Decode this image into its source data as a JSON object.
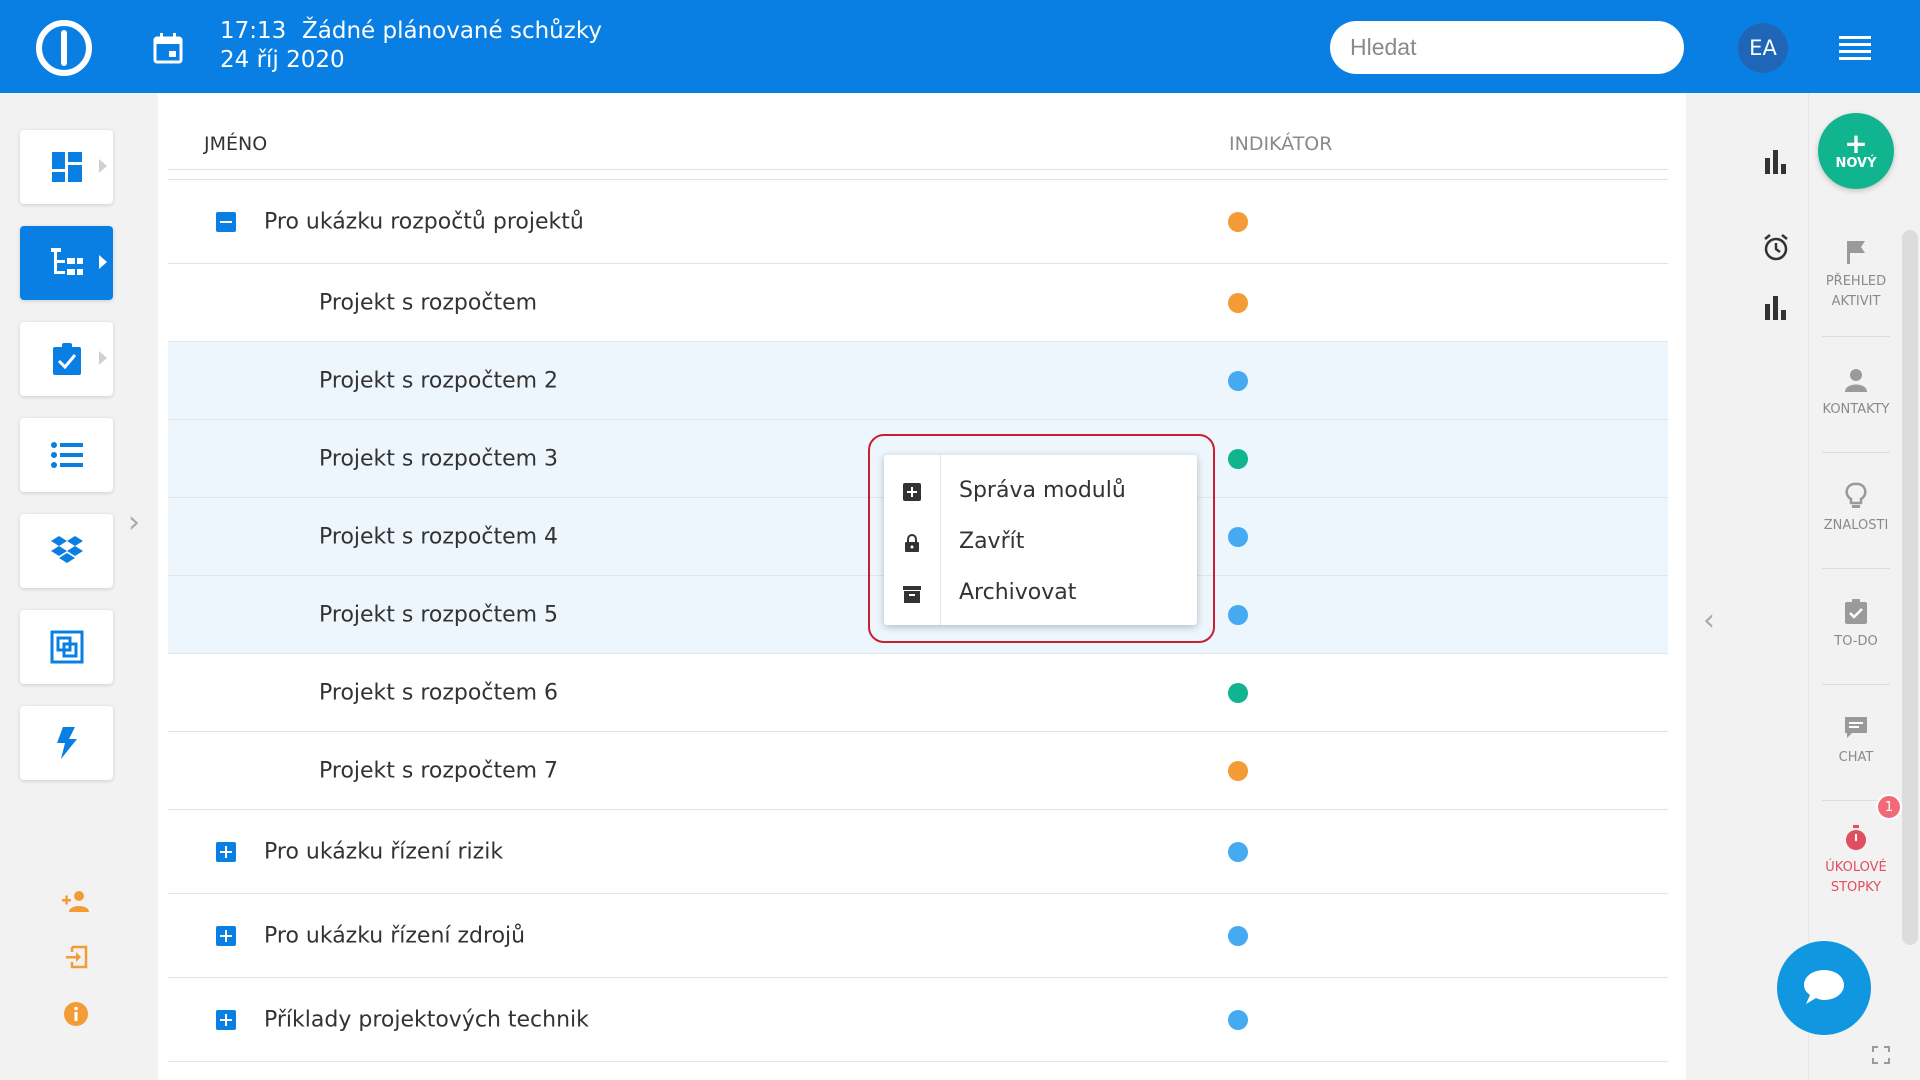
{
  "header": {
    "time": "17:13",
    "meeting": "Žádné plánované schůzky",
    "date": "24 říj 2020",
    "search_placeholder": "Hledat",
    "avatar": "EA",
    "logo_icon": "power-logo-icon",
    "calendar_icon": "calendar-icon",
    "menu_icon": "hamburger-icon"
  },
  "left_nav": {
    "items": [
      {
        "icon": "dashboard-icon",
        "active": false,
        "has_arrow": true
      },
      {
        "icon": "project-tree-icon",
        "active": true,
        "has_arrow": true
      },
      {
        "icon": "clipboard-check-icon",
        "active": false,
        "has_arrow": true
      },
      {
        "icon": "list-icon",
        "active": false,
        "has_arrow": false
      },
      {
        "icon": "dropbox-icon",
        "active": false,
        "has_arrow": false
      },
      {
        "icon": "resource-icon",
        "active": false,
        "has_arrow": false
      },
      {
        "icon": "lightning-icon",
        "active": false,
        "has_arrow": false
      }
    ],
    "bottom_icons": [
      "add-user-icon",
      "sign-in-icon",
      "info-icon"
    ],
    "accent": "#0a7fe3",
    "orange": "#f39c35"
  },
  "table": {
    "col_name": "JMÉNO",
    "col_indicator": "INDIKÁTOR",
    "rows": [
      {
        "label": "Pro ukázku rozpočtů projektů",
        "level": 0,
        "toggle": "minus",
        "indicator": "#f39c35",
        "selected": false
      },
      {
        "label": "Projekt s rozpočtem",
        "level": 1,
        "toggle": "",
        "indicator": "#f39c35",
        "selected": false
      },
      {
        "label": "Projekt s rozpočtem 2",
        "level": 1,
        "toggle": "",
        "indicator": "#45aaf2",
        "selected": true
      },
      {
        "label": "Projekt s rozpočtem 3",
        "level": 1,
        "toggle": "",
        "indicator": "#10b58f",
        "selected": true
      },
      {
        "label": "Projekt s rozpočtem 4",
        "level": 1,
        "toggle": "",
        "indicator": "#45aaf2",
        "selected": true
      },
      {
        "label": "Projekt s rozpočtem 5",
        "level": 1,
        "toggle": "",
        "indicator": "#45aaf2",
        "selected": true
      },
      {
        "label": "Projekt s rozpočtem 6",
        "level": 1,
        "toggle": "",
        "indicator": "#10b58f",
        "selected": false
      },
      {
        "label": "Projekt s rozpočtem 7",
        "level": 1,
        "toggle": "",
        "indicator": "#f39c35",
        "selected": false
      },
      {
        "label": "Pro ukázku řízení rizik",
        "level": 0,
        "toggle": "plus",
        "indicator": "#45aaf2",
        "selected": false
      },
      {
        "label": "Pro ukázku řízení zdrojů",
        "level": 0,
        "toggle": "plus",
        "indicator": "#45aaf2",
        "selected": false
      },
      {
        "label": "Příklady projektových technik",
        "level": 0,
        "toggle": "plus",
        "indicator": "#45aaf2",
        "selected": false
      }
    ]
  },
  "context_menu": {
    "items": [
      {
        "label": "Správa modulů",
        "icon": "plus-square-icon"
      },
      {
        "label": "Zavřít",
        "icon": "lock-icon"
      },
      {
        "label": "Archivovat",
        "icon": "archive-icon"
      }
    ],
    "highlight_color": "#c9202f"
  },
  "right_sidebar": {
    "new_button": "NOVÝ",
    "items": [
      {
        "label_lines": [
          "PŘEHLED",
          "AKTIVIT"
        ],
        "icon": "flag-icon"
      },
      {
        "label_lines": [
          "KONTAKTY"
        ],
        "icon": "person-icon"
      },
      {
        "label_lines": [
          "ZNALOSTI"
        ],
        "icon": "lightbulb-icon"
      },
      {
        "label_lines": [
          "TO-DO"
        ],
        "icon": "todo-icon"
      },
      {
        "label_lines": [
          "CHAT"
        ],
        "icon": "chat-icon"
      },
      {
        "label_lines": [
          "ÚKOLOVÉ",
          "STOPKY"
        ],
        "icon": "stopwatch-icon"
      }
    ],
    "timer_badge": "1",
    "strip_icons": [
      "bar-chart-icon",
      "alarm-icon",
      "bar-chart-icon"
    ]
  }
}
